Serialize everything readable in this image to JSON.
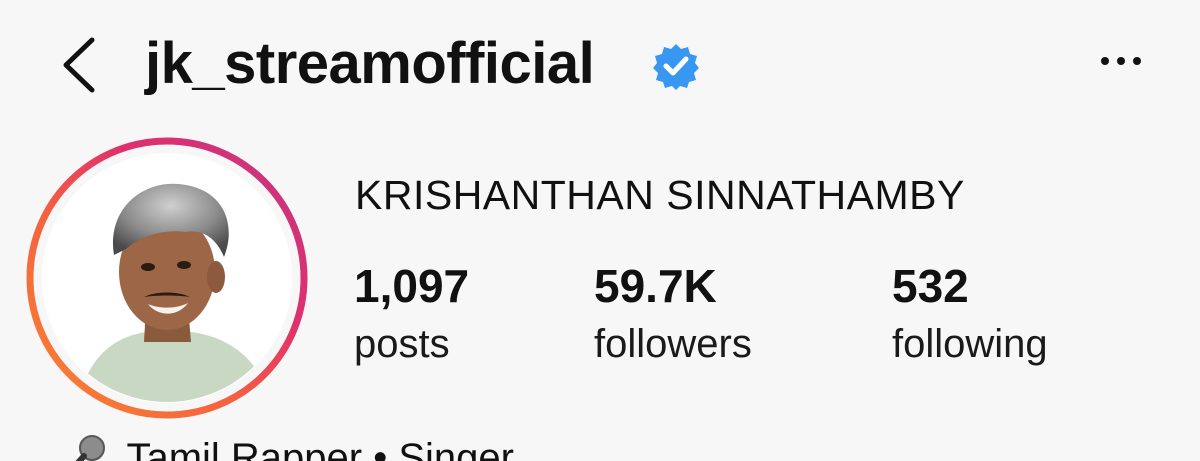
{
  "profile": {
    "username": "jk_streamofficial",
    "full_name": "KRISHANTHAN SINNATHAMBY",
    "verified": true,
    "bio_line": "Tamil Rapper • Singer"
  },
  "stats": {
    "posts": {
      "value": "1,097",
      "label": "posts"
    },
    "followers": {
      "value": "59.7K",
      "label": "followers"
    },
    "following": {
      "value": "532",
      "label": "following"
    }
  },
  "icons": {
    "back": "chevron-left-icon",
    "verified": "verified-badge-icon",
    "more": "more-horizontal-icon",
    "bio": "microphone-icon"
  },
  "colors": {
    "background": "#f7f7f7",
    "text": "#111111",
    "verified_blue": "#3897f0",
    "story_ring_start": "#d62976",
    "story_ring_mid": "#f5455c",
    "story_ring_end": "#feda75"
  }
}
